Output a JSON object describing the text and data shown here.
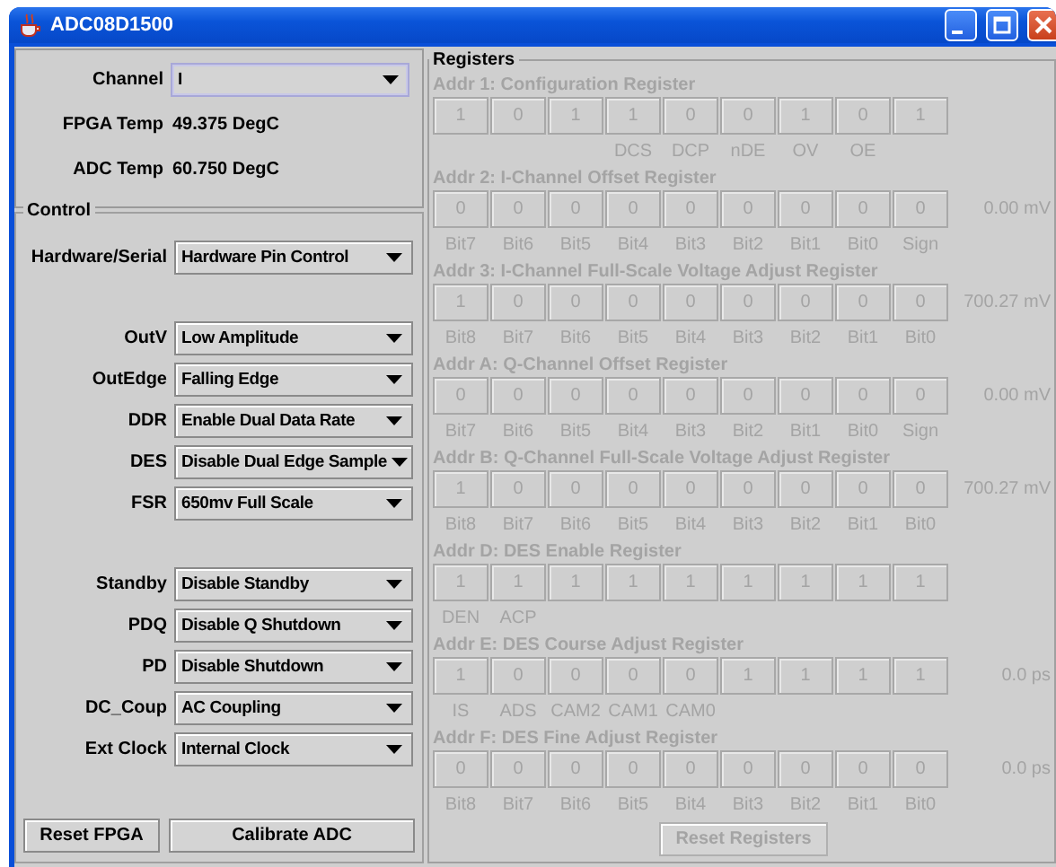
{
  "window": {
    "title": "ADC08D1500"
  },
  "status": [
    {
      "label": "Channel",
      "kind": "dropdown",
      "value": "I",
      "focused": true
    },
    {
      "label": "FPGA Temp",
      "kind": "reading",
      "value": "49.375 DegC"
    },
    {
      "label": "ADC Temp",
      "kind": "reading",
      "value": "60.750 DegC"
    }
  ],
  "control": {
    "title": "Control",
    "groups": [
      [
        {
          "label": "Hardware/Serial",
          "value": "Hardware Pin Control",
          "focused": false
        }
      ],
      [
        {
          "label": "OutV",
          "value": "Low Amplitude",
          "focused": false
        },
        {
          "label": "OutEdge",
          "value": "Falling Edge",
          "focused": false
        },
        {
          "label": "DDR",
          "value": "Enable Dual Data Rate",
          "focused": false
        },
        {
          "label": "DES",
          "value": "Disable Dual Edge Sample",
          "focused": false
        },
        {
          "label": "FSR",
          "value": "650mv Full Scale",
          "focused": false
        }
      ],
      [
        {
          "label": "Standby",
          "value": "Disable Standby",
          "focused": false
        },
        {
          "label": "PDQ",
          "value": "Disable Q Shutdown",
          "focused": false
        },
        {
          "label": "PD",
          "value": "Disable Shutdown",
          "focused": false
        },
        {
          "label": "DC_Coup",
          "value": "AC Coupling",
          "focused": false
        },
        {
          "label": "Ext Clock",
          "value": "Internal Clock",
          "focused": false
        }
      ]
    ],
    "buttons": [
      "Reset FPGA",
      "Calibrate ADC"
    ]
  },
  "registers": {
    "title": "Registers",
    "disabled": true,
    "items": [
      {
        "title": "Addr 1: Configuration Register",
        "bits": [
          "1",
          "0",
          "1",
          "1",
          "0",
          "0",
          "1",
          "0",
          "1"
        ],
        "kind": "config",
        "labels": [
          "DCS",
          "DCP",
          "nDE",
          "OV",
          "OE"
        ]
      },
      {
        "title": "Addr 2: I-Channel Offset Register",
        "bits": [
          "0",
          "0",
          "0",
          "0",
          "0",
          "0",
          "0",
          "0",
          "0"
        ],
        "reading": "0.00 mV",
        "labels": [
          "Bit7",
          "Bit6",
          "Bit5",
          "Bit4",
          "Bit3",
          "Bit2",
          "Bit1",
          "Bit0",
          "Sign"
        ]
      },
      {
        "title": "Addr 3: I-Channel Full-Scale Voltage Adjust Register",
        "bits": [
          "1",
          "0",
          "0",
          "0",
          "0",
          "0",
          "0",
          "0",
          "0"
        ],
        "reading": "700.27 mV",
        "labels": [
          "Bit8",
          "Bit7",
          "Bit6",
          "Bit5",
          "Bit4",
          "Bit3",
          "Bit2",
          "Bit1",
          "Bit0"
        ]
      },
      {
        "title": "Addr A: Q-Channel Offset Register",
        "bits": [
          "0",
          "0",
          "0",
          "0",
          "0",
          "0",
          "0",
          "0",
          "0"
        ],
        "reading": "0.00 mV",
        "labels": [
          "Bit7",
          "Bit6",
          "Bit5",
          "Bit4",
          "Bit3",
          "Bit2",
          "Bit1",
          "Bit0",
          "Sign"
        ]
      },
      {
        "title": "Addr B: Q-Channel Full-Scale Voltage Adjust Register",
        "bits": [
          "1",
          "0",
          "0",
          "0",
          "0",
          "0",
          "0",
          "0",
          "0"
        ],
        "reading": "700.27 mV",
        "labels": [
          "Bit8",
          "Bit7",
          "Bit6",
          "Bit5",
          "Bit4",
          "Bit3",
          "Bit2",
          "Bit1",
          "Bit0"
        ]
      },
      {
        "title": "Addr D: DES Enable Register",
        "bits": [
          "1",
          "1",
          "1",
          "1",
          "1",
          "1",
          "1",
          "1",
          "1"
        ],
        "kind": "flags",
        "labels": [
          "DEN",
          "ACP"
        ]
      },
      {
        "title": "Addr E: DES Course Adjust Register",
        "bits": [
          "1",
          "0",
          "0",
          "0",
          "0",
          "1",
          "1",
          "1",
          "1"
        ],
        "reading": "0.0 ps",
        "kind": "flags",
        "labels": [
          "IS",
          "ADS",
          "CAM2",
          "CAM1",
          "CAM0"
        ]
      },
      {
        "title": "Addr F: DES Fine Adjust Register",
        "bits": [
          "0",
          "0",
          "0",
          "0",
          "0",
          "0",
          "0",
          "0",
          "0"
        ],
        "reading": "0.0 ps",
        "labels": [
          "Bit8",
          "Bit7",
          "Bit6",
          "Bit5",
          "Bit4",
          "Bit3",
          "Bit2",
          "Bit1",
          "Bit0"
        ]
      }
    ],
    "reset_button": "Reset Registers"
  }
}
